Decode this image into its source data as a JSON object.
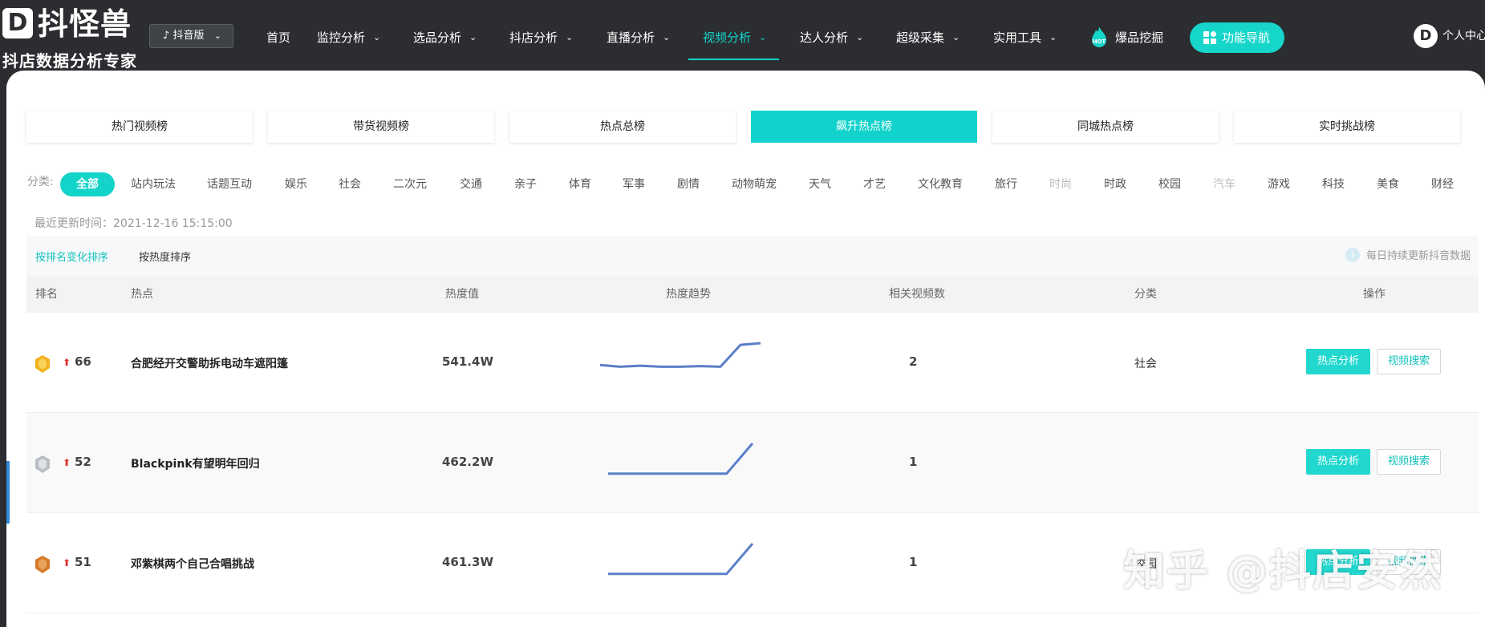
{
  "brand": {
    "name": "抖怪兽",
    "mark": "D",
    "tagline": "抖店数据分析专家"
  },
  "version_select": {
    "value": "抖音版"
  },
  "nav": {
    "items": [
      {
        "label": "首页",
        "dropdown": false
      },
      {
        "label": "监控分析",
        "dropdown": true
      },
      {
        "label": "选品分析",
        "dropdown": true
      },
      {
        "label": "抖店分析",
        "dropdown": true
      },
      {
        "label": "直播分析",
        "dropdown": true
      },
      {
        "label": "视频分析",
        "dropdown": true,
        "active": true
      },
      {
        "label": "达人分析",
        "dropdown": true
      },
      {
        "label": "超级采集",
        "dropdown": true
      },
      {
        "label": "实用工具",
        "dropdown": true
      }
    ],
    "hot_label": "爆品挖掘",
    "hot_badge": "HOT",
    "guide_label": "功能导航",
    "user_label": "个人中心"
  },
  "tabs": [
    "热门视频榜",
    "带货视频榜",
    "热点总榜",
    "飙升热点榜",
    "同城热点榜",
    "实时挑战榜"
  ],
  "active_tab": "飙升热点榜",
  "categories": {
    "label": "分类:",
    "items": [
      "全部",
      "站内玩法",
      "话题互动",
      "娱乐",
      "社会",
      "二次元",
      "交通",
      "亲子",
      "体育",
      "军事",
      "剧情",
      "动物萌宠",
      "天气",
      "才艺",
      "文化教育",
      "旅行",
      "时尚",
      "时政",
      "校园",
      "汽车",
      "游戏",
      "科技",
      "美食",
      "财经"
    ],
    "active": "全部",
    "dimmed": [
      "时尚",
      "汽车"
    ]
  },
  "updated_text": "最近更新时间：2021-12-16 15:15:00",
  "sort": {
    "by_rank_change": "按排名变化排序",
    "by_heat": "按热度排序",
    "note": "每日持续更新抖音数据"
  },
  "table": {
    "headers": [
      "排名",
      "热点",
      "热度值",
      "热度趋势",
      "相关视频数",
      "分类",
      "操作"
    ],
    "rows": [
      {
        "medal": "gold",
        "rank": "66",
        "rank_change": "up",
        "topic": "合肥经开交警助拆电动车遮阳篷",
        "heat": "541.4W",
        "trend": [
          0.35,
          0.3,
          0.33,
          0.3,
          0.3,
          0.32,
          0.3,
          0.95,
          1.0
        ],
        "videos": "2",
        "category": "社会",
        "action_primary": "热点分析",
        "action_secondary": "视频搜索"
      },
      {
        "medal": "silver",
        "rank": "52",
        "rank_change": "up",
        "topic": "Blackpink有望明年回归",
        "heat": "462.2W",
        "trend": [
          0.1,
          0.1,
          0.1,
          0.1,
          0.1,
          0.1,
          1.0
        ],
        "videos": "1",
        "category": "",
        "action_primary": "热点分析",
        "action_secondary": "视频搜索"
      },
      {
        "medal": "bronze",
        "rank": "51",
        "rank_change": "up",
        "topic": "邓紫棋两个自己合唱挑战",
        "heat": "461.3W",
        "trend": [
          0.1,
          0.1,
          0.1,
          0.1,
          0.1,
          0.1,
          1.0
        ],
        "videos": "1",
        "category": "校园",
        "action_primary": "热点分析",
        "action_secondary": "视频搜索"
      }
    ]
  },
  "watermark": "知乎 @抖店安然",
  "colors": {
    "accent": "#12d3cb",
    "topbar": "#2b2d30",
    "trend_line": "#5b7fc7",
    "rank_up": "#d9312b"
  }
}
